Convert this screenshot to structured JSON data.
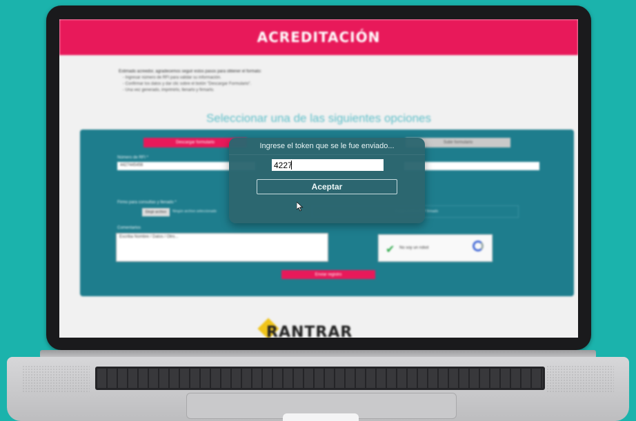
{
  "site": {
    "header_title": "ACREDITACIÓN",
    "intro_lines": [
      "Estimado acreedor, agradecemos seguir estos pasos para obtener el formato:",
      "- Ingresar número de RFI para validar su información.",
      "- Confirmar los datos y dar clic sobre el botón \"Descargar Formulario\".",
      "- Una vez generado, imprimirlo, llenarlo y firmarlo."
    ],
    "select_title": "Seleccionar una de las siguientes opciones",
    "tabs": [
      "Descargar formulario",
      "Subir formulario"
    ],
    "field_rfi_label": "Número de RFI *",
    "field_rfi_value": "4427445456",
    "file_label": "Firmo para consultas y llenado *",
    "file_button": "Elegir archivo",
    "file_status": "Ningún archivo seleccionado",
    "file_drop_hint": "Cargar archivo PDF firmado",
    "comments_label": "Comentarios",
    "comments_placeholder": "Escriba Nombre / Datos / Otro...",
    "captcha_text": "No soy un robot",
    "send_button": "Enviar registro",
    "brand": "RANTRAR"
  },
  "modal": {
    "title": "Ingrese el token que se le fue enviado...",
    "token_value": "4227",
    "accept_label": "Aceptar"
  },
  "colors": {
    "background": "#1bb3ac",
    "header_pink": "#e8195a",
    "panel_teal": "#1e7d8d",
    "modal_teal": "#2c6670"
  }
}
